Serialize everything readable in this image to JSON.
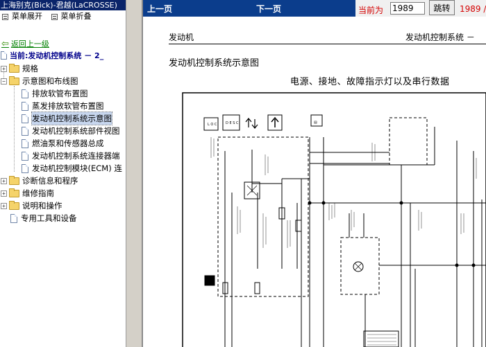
{
  "left_pane": {
    "title": "上海别克(Bick)-君越(LaCROSSE)",
    "menu": {
      "expand": "菜单展开",
      "collapse": "菜单折叠"
    },
    "back_link": "返回上一级",
    "current": "当前:发动机控制系统 － 2_",
    "tree": [
      {
        "label": "规格",
        "type": "folder",
        "expander": "+"
      },
      {
        "label": "示意图和布线图",
        "type": "folder",
        "expander": "−"
      },
      {
        "label": "排放软管布置图",
        "type": "doc"
      },
      {
        "label": "蒸发排放软管布置图",
        "type": "doc"
      },
      {
        "label": "发动机控制系统示意图",
        "type": "doc",
        "selected": true
      },
      {
        "label": "发动机控制系统部件视图",
        "type": "doc"
      },
      {
        "label": "燃油泵和传感器总成",
        "type": "doc"
      },
      {
        "label": "发动机控制系统连接器端",
        "type": "doc"
      },
      {
        "label": "发动机控制模块(ECM) 连",
        "type": "doc"
      },
      {
        "label": "诊断信息和程序",
        "type": "folder",
        "expander": "+"
      },
      {
        "label": "维修指南",
        "type": "folder",
        "expander": "+"
      },
      {
        "label": "说明和操作",
        "type": "folder",
        "expander": "+"
      },
      {
        "label": "专用工具和设备",
        "type": "doc"
      }
    ]
  },
  "toolbar": {
    "prev": "上一页",
    "next": "下一页",
    "current_label": "当前为",
    "page_value": "1989",
    "jump": "跳转",
    "page_echo": "1989 /"
  },
  "document": {
    "header_left": "发动机",
    "header_right": "发动机控制系统 －",
    "title": "发动机控制系统示意图",
    "diagram_title": "电源、接地、故障指示灯以及串行数据"
  },
  "colors": {
    "topbar": "#0b3d8c",
    "left_title": "#0a246a",
    "accent_red": "#d40000",
    "link_green": "#008000",
    "current_blue": "#00008b",
    "selected": "#c7d6ee"
  },
  "icons": [
    "menu-expand-icon",
    "menu-collapse-icon",
    "back-arrow-icon",
    "document-icon",
    "folder-icon"
  ]
}
